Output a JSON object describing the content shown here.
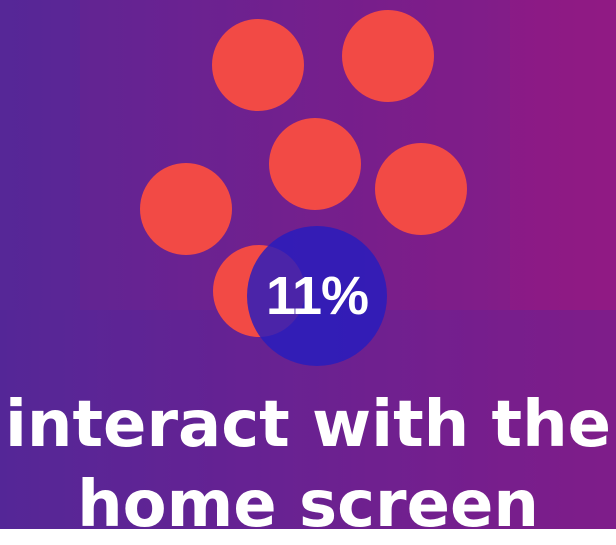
{
  "stat": {
    "value": "11%",
    "fraction": 0.11
  },
  "caption": {
    "line1": "interact with the",
    "line2": "home screen"
  },
  "colors": {
    "background_left": "#5a2795",
    "background_right": "#8e1b85",
    "dot": "#f24a45",
    "highlight_circle": "#261cbe",
    "text": "#ffffff"
  }
}
